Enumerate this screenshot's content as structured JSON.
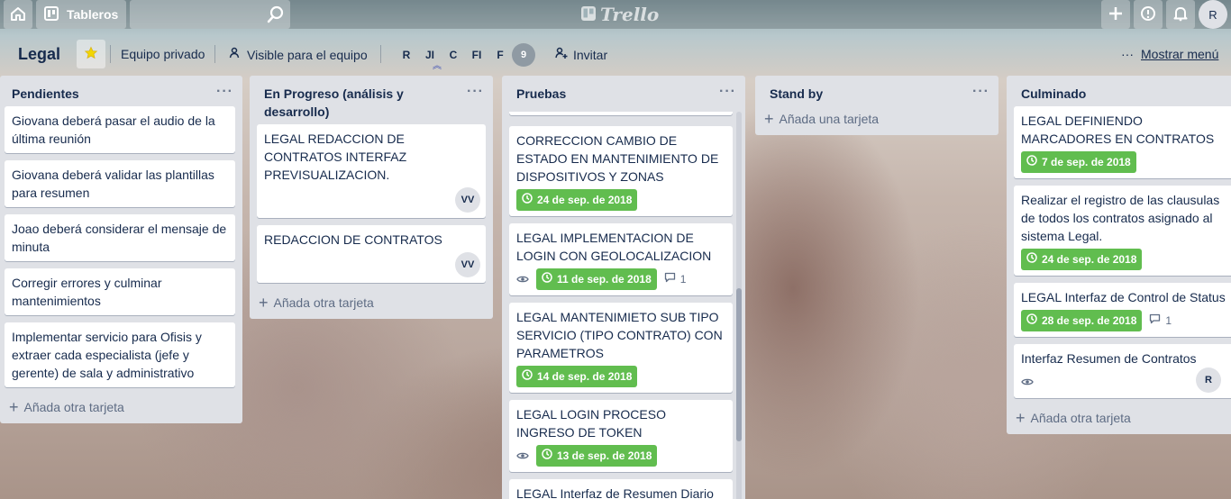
{
  "topbar": {
    "boards_label": "Tableros",
    "search_placeholder": "",
    "logo_text": "Trello",
    "user_initial": "R"
  },
  "board": {
    "title": "Legal",
    "team_label": "Equipo privado",
    "visibility_label": "Visible para el equipo",
    "members": [
      "R",
      "JI",
      "C",
      "FI",
      "F"
    ],
    "member_count": "9",
    "invite_label": "Invitar",
    "menu_label": "Mostrar menú"
  },
  "lists": [
    {
      "name": "Pendientes",
      "cards": [
        {
          "text": "Giovana deberá pasar el audio de la última reunión"
        },
        {
          "text": "Giovana deberá validar las plantillas para resumen"
        },
        {
          "text": "Joao deberá considerar el mensaje de minuta"
        },
        {
          "text": "Corregir errores y culminar mantenimientos"
        },
        {
          "text": "Implementar servicio para Ofisis y extraer cada especialista (jefe y gerente) de sala y administrativo"
        }
      ],
      "add_label": "Añada otra tarjeta"
    },
    {
      "name": "En Progreso (análisis y desarrollo)",
      "cards": [
        {
          "text": "LEGAL REDACCION DE CONTRATOS INTERFAZ PREVISUALIZACION.",
          "member": "VV"
        },
        {
          "text": "REDACCION DE CONTRATOS",
          "member": "VV"
        }
      ],
      "add_label": "Añada otra tarjeta"
    },
    {
      "name": "Pruebas",
      "cards": [
        {
          "text": "CORRECCION CAMBIO DE ESTADO EN MANTENIMIENTO DE DISPOSITIVOS Y ZONAS",
          "due": "24 de sep. de 2018"
        },
        {
          "text": "LEGAL IMPLEMENTACION DE LOGIN CON GEOLOCALIZACION",
          "due": "11 de sep. de 2018",
          "comments": "1"
        },
        {
          "text": "LEGAL MANTENIMIETO SUB TIPO SERVICIO (TIPO CONTRATO) CON PARAMETROS",
          "due": "14 de sep. de 2018"
        },
        {
          "text": "LEGAL LOGIN PROCESO INGRESO DE TOKEN",
          "due": "13 de sep. de 2018"
        },
        {
          "text": "LEGAL Interfaz de Resumen Diario"
        }
      ]
    },
    {
      "name": "Stand by",
      "cards": [],
      "add_label": "Añada una tarjeta"
    },
    {
      "name": "Culminado",
      "cards": [
        {
          "text": "LEGAL DEFINIENDO MARCADORES EN CONTRATOS",
          "due": "7 de sep. de 2018"
        },
        {
          "text": "Realizar el registro de las clausulas de todos los contratos asignado al sistema Legal.",
          "due": "24 de sep. de 2018"
        },
        {
          "text": "LEGAL Interfaz de Control de Status",
          "due": "28 de sep. de 2018",
          "comments": "1"
        },
        {
          "text": "Interfaz Resumen de Contratos",
          "member": "R"
        }
      ],
      "add_label": "Añada otra tarjeta"
    }
  ],
  "colors": {
    "due_green": "#61bd4f",
    "list_bg": "#dfe1e6",
    "text": "#172b4d",
    "star": "#f2d600"
  }
}
